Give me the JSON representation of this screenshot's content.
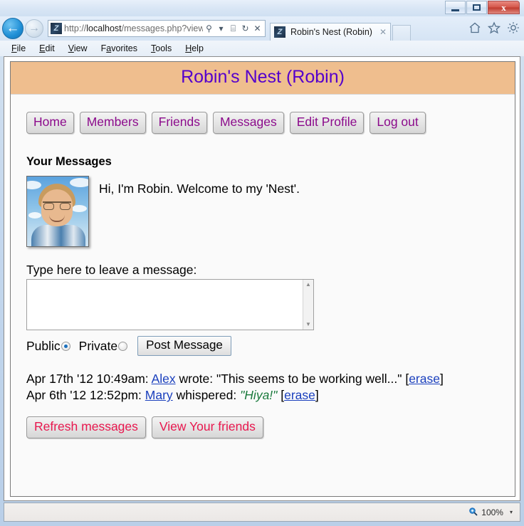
{
  "window": {
    "minimize_label": "Minimize",
    "maximize_label": "Maximize",
    "close_label": "x"
  },
  "browser": {
    "back_arrow": "←",
    "forward_arrow": "→",
    "url_prefix": "http://",
    "url_host": "localhost",
    "url_path": "/messages.php?view",
    "favicon_letter": "Z",
    "address_icons": {
      "search": "⚲",
      "dropdown": "▾",
      "compat": "⌸",
      "refresh": "↻",
      "stop": "✕"
    },
    "tab": {
      "title": "Robin's Nest (Robin)",
      "close_label": "✕",
      "favicon_letter": "Z"
    },
    "new_tab_label": "",
    "toolbar_icons": {
      "home": "home-icon",
      "favorites": "star-icon",
      "tools": "gear-icon"
    },
    "menu": [
      {
        "label": "File",
        "accel": "F",
        "rest": "ile"
      },
      {
        "label": "Edit",
        "accel": "E",
        "rest": "dit"
      },
      {
        "label": "View",
        "accel": "V",
        "rest": "iew"
      },
      {
        "label": "Favorites",
        "accel": "a",
        "pre": "F",
        "rest": "vorites"
      },
      {
        "label": "Tools",
        "accel": "T",
        "rest": "ools"
      },
      {
        "label": "Help",
        "accel": "H",
        "rest": "elp"
      }
    ]
  },
  "page": {
    "site_title": "Robin's Nest (Robin)",
    "header_bg": "#efbe8e",
    "title_color": "#5500cc",
    "nav_buttons": [
      "Home",
      "Members",
      "Friends",
      "Messages",
      "Edit Profile",
      "Log out"
    ],
    "nav_button_color": "#8b0a8b",
    "messages_heading": "Your Messages",
    "greeting": "Hi, I'm Robin. Welcome to my 'Nest'.",
    "compose_label": "Type here to leave a message:",
    "compose_value": "",
    "compose_placeholder": "",
    "privacy": {
      "public_label": "Public",
      "private_label": "Private",
      "selected": "Public"
    },
    "post_button": "Post Message",
    "messages": [
      {
        "timestamp": "Apr 17th '12 10:49am:",
        "author": "Alex",
        "verb": "wrote:",
        "body": "\"This seems to be working well...\"",
        "private": false,
        "erase_label": "erase"
      },
      {
        "timestamp": "Apr 6th '12 12:52pm:",
        "author": "Mary",
        "verb": "whispered:",
        "body": "\"Hiya!\"",
        "private": true,
        "erase_label": "erase"
      }
    ],
    "bottom_buttons": [
      "Refresh messages",
      "View Your friends"
    ],
    "bottom_button_color": "#e8174e",
    "link_color": "#1a3fbd",
    "whisper_color": "#1a7a3c"
  },
  "statusbar": {
    "zoom_level": "100%",
    "zoom_icon": "zoom-icon",
    "caret": "▾"
  }
}
